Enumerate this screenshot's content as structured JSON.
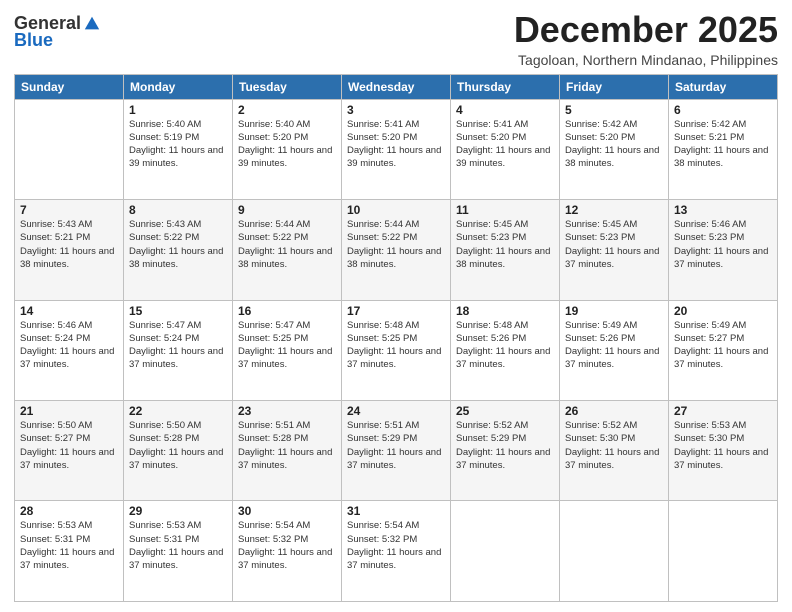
{
  "header": {
    "logo_general": "General",
    "logo_blue": "Blue",
    "month_title": "December 2025",
    "subtitle": "Tagoloan, Northern Mindanao, Philippines"
  },
  "days_of_week": [
    "Sunday",
    "Monday",
    "Tuesday",
    "Wednesday",
    "Thursday",
    "Friday",
    "Saturday"
  ],
  "weeks": [
    [
      {
        "day": "",
        "sunrise": "",
        "sunset": "",
        "daylight": ""
      },
      {
        "day": "1",
        "sunrise": "Sunrise: 5:40 AM",
        "sunset": "Sunset: 5:19 PM",
        "daylight": "Daylight: 11 hours and 39 minutes."
      },
      {
        "day": "2",
        "sunrise": "Sunrise: 5:40 AM",
        "sunset": "Sunset: 5:20 PM",
        "daylight": "Daylight: 11 hours and 39 minutes."
      },
      {
        "day": "3",
        "sunrise": "Sunrise: 5:41 AM",
        "sunset": "Sunset: 5:20 PM",
        "daylight": "Daylight: 11 hours and 39 minutes."
      },
      {
        "day": "4",
        "sunrise": "Sunrise: 5:41 AM",
        "sunset": "Sunset: 5:20 PM",
        "daylight": "Daylight: 11 hours and 39 minutes."
      },
      {
        "day": "5",
        "sunrise": "Sunrise: 5:42 AM",
        "sunset": "Sunset: 5:20 PM",
        "daylight": "Daylight: 11 hours and 38 minutes."
      },
      {
        "day": "6",
        "sunrise": "Sunrise: 5:42 AM",
        "sunset": "Sunset: 5:21 PM",
        "daylight": "Daylight: 11 hours and 38 minutes."
      }
    ],
    [
      {
        "day": "7",
        "sunrise": "Sunrise: 5:43 AM",
        "sunset": "Sunset: 5:21 PM",
        "daylight": "Daylight: 11 hours and 38 minutes."
      },
      {
        "day": "8",
        "sunrise": "Sunrise: 5:43 AM",
        "sunset": "Sunset: 5:22 PM",
        "daylight": "Daylight: 11 hours and 38 minutes."
      },
      {
        "day": "9",
        "sunrise": "Sunrise: 5:44 AM",
        "sunset": "Sunset: 5:22 PM",
        "daylight": "Daylight: 11 hours and 38 minutes."
      },
      {
        "day": "10",
        "sunrise": "Sunrise: 5:44 AM",
        "sunset": "Sunset: 5:22 PM",
        "daylight": "Daylight: 11 hours and 38 minutes."
      },
      {
        "day": "11",
        "sunrise": "Sunrise: 5:45 AM",
        "sunset": "Sunset: 5:23 PM",
        "daylight": "Daylight: 11 hours and 38 minutes."
      },
      {
        "day": "12",
        "sunrise": "Sunrise: 5:45 AM",
        "sunset": "Sunset: 5:23 PM",
        "daylight": "Daylight: 11 hours and 37 minutes."
      },
      {
        "day": "13",
        "sunrise": "Sunrise: 5:46 AM",
        "sunset": "Sunset: 5:23 PM",
        "daylight": "Daylight: 11 hours and 37 minutes."
      }
    ],
    [
      {
        "day": "14",
        "sunrise": "Sunrise: 5:46 AM",
        "sunset": "Sunset: 5:24 PM",
        "daylight": "Daylight: 11 hours and 37 minutes."
      },
      {
        "day": "15",
        "sunrise": "Sunrise: 5:47 AM",
        "sunset": "Sunset: 5:24 PM",
        "daylight": "Daylight: 11 hours and 37 minutes."
      },
      {
        "day": "16",
        "sunrise": "Sunrise: 5:47 AM",
        "sunset": "Sunset: 5:25 PM",
        "daylight": "Daylight: 11 hours and 37 minutes."
      },
      {
        "day": "17",
        "sunrise": "Sunrise: 5:48 AM",
        "sunset": "Sunset: 5:25 PM",
        "daylight": "Daylight: 11 hours and 37 minutes."
      },
      {
        "day": "18",
        "sunrise": "Sunrise: 5:48 AM",
        "sunset": "Sunset: 5:26 PM",
        "daylight": "Daylight: 11 hours and 37 minutes."
      },
      {
        "day": "19",
        "sunrise": "Sunrise: 5:49 AM",
        "sunset": "Sunset: 5:26 PM",
        "daylight": "Daylight: 11 hours and 37 minutes."
      },
      {
        "day": "20",
        "sunrise": "Sunrise: 5:49 AM",
        "sunset": "Sunset: 5:27 PM",
        "daylight": "Daylight: 11 hours and 37 minutes."
      }
    ],
    [
      {
        "day": "21",
        "sunrise": "Sunrise: 5:50 AM",
        "sunset": "Sunset: 5:27 PM",
        "daylight": "Daylight: 11 hours and 37 minutes."
      },
      {
        "day": "22",
        "sunrise": "Sunrise: 5:50 AM",
        "sunset": "Sunset: 5:28 PM",
        "daylight": "Daylight: 11 hours and 37 minutes."
      },
      {
        "day": "23",
        "sunrise": "Sunrise: 5:51 AM",
        "sunset": "Sunset: 5:28 PM",
        "daylight": "Daylight: 11 hours and 37 minutes."
      },
      {
        "day": "24",
        "sunrise": "Sunrise: 5:51 AM",
        "sunset": "Sunset: 5:29 PM",
        "daylight": "Daylight: 11 hours and 37 minutes."
      },
      {
        "day": "25",
        "sunrise": "Sunrise: 5:52 AM",
        "sunset": "Sunset: 5:29 PM",
        "daylight": "Daylight: 11 hours and 37 minutes."
      },
      {
        "day": "26",
        "sunrise": "Sunrise: 5:52 AM",
        "sunset": "Sunset: 5:30 PM",
        "daylight": "Daylight: 11 hours and 37 minutes."
      },
      {
        "day": "27",
        "sunrise": "Sunrise: 5:53 AM",
        "sunset": "Sunset: 5:30 PM",
        "daylight": "Daylight: 11 hours and 37 minutes."
      }
    ],
    [
      {
        "day": "28",
        "sunrise": "Sunrise: 5:53 AM",
        "sunset": "Sunset: 5:31 PM",
        "daylight": "Daylight: 11 hours and 37 minutes."
      },
      {
        "day": "29",
        "sunrise": "Sunrise: 5:53 AM",
        "sunset": "Sunset: 5:31 PM",
        "daylight": "Daylight: 11 hours and 37 minutes."
      },
      {
        "day": "30",
        "sunrise": "Sunrise: 5:54 AM",
        "sunset": "Sunset: 5:32 PM",
        "daylight": "Daylight: 11 hours and 37 minutes."
      },
      {
        "day": "31",
        "sunrise": "Sunrise: 5:54 AM",
        "sunset": "Sunset: 5:32 PM",
        "daylight": "Daylight: 11 hours and 37 minutes."
      },
      {
        "day": "",
        "sunrise": "",
        "sunset": "",
        "daylight": ""
      },
      {
        "day": "",
        "sunrise": "",
        "sunset": "",
        "daylight": ""
      },
      {
        "day": "",
        "sunrise": "",
        "sunset": "",
        "daylight": ""
      }
    ]
  ]
}
